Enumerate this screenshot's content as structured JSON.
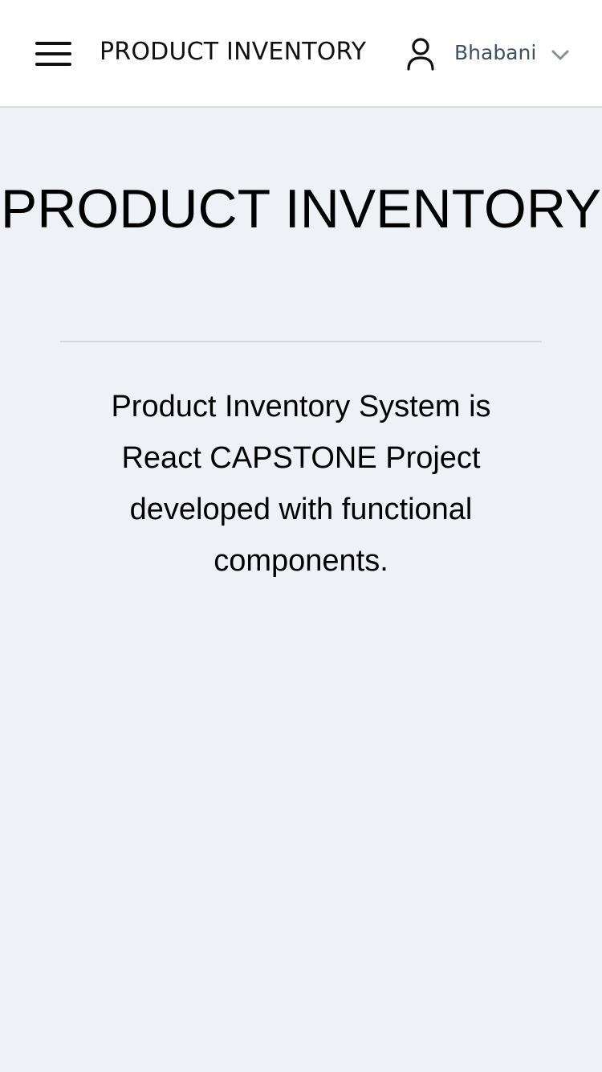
{
  "header": {
    "app_title": "PRODUCT INVENTORY",
    "menu_icon": "hamburger-menu-icon",
    "user": {
      "icon": "user-icon",
      "name": "Bhabani",
      "dropdown_icon": "chevron-down-icon"
    }
  },
  "main": {
    "title": "PRODUCT INVENTORY",
    "description": "Product Inventory System is React CAPSTONE Project developed with functional components."
  },
  "colors": {
    "background": "#eef1f6",
    "header_background": "#ffffff",
    "username_text": "#3f4f66",
    "divider": "#d4d7db"
  }
}
